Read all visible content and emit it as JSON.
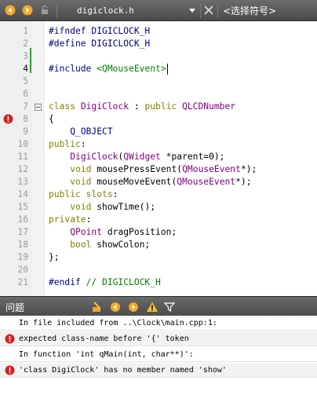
{
  "toolbar": {
    "back_icon": "arrow-left-icon",
    "forward_icon": "arrow-right-icon",
    "lock_icon": "lock-icon",
    "file_name": "digiclock.h",
    "symbol_placeholder": "<选择符号>",
    "accent_color": "#f5a623"
  },
  "editor": {
    "lines": [
      {
        "n": "1",
        "text": "#ifndef DIGICLOCK_H"
      },
      {
        "n": "2",
        "text": "#define DIGICLOCK_H"
      },
      {
        "n": "3",
        "text": ""
      },
      {
        "n": "4",
        "text": "#include <QMouseEvent>"
      },
      {
        "n": "5",
        "text": ""
      },
      {
        "n": "6",
        "text": ""
      },
      {
        "n": "7",
        "text": "class DigiClock : public QLCDNumber"
      },
      {
        "n": "8",
        "text": "{"
      },
      {
        "n": "9",
        "text": "    Q_OBJECT"
      },
      {
        "n": "10",
        "text": "public:"
      },
      {
        "n": "11",
        "text": "    DigiClock(QWidget *parent=0);"
      },
      {
        "n": "12",
        "text": "    void mousePressEvent(QMouseEvent*);"
      },
      {
        "n": "13",
        "text": "    void mouseMoveEvent(QMouseEvent*);"
      },
      {
        "n": "14",
        "text": "public slots:"
      },
      {
        "n": "15",
        "text": "    void showTime();"
      },
      {
        "n": "16",
        "text": "private:"
      },
      {
        "n": "17",
        "text": "    QPoint dragPosition;"
      },
      {
        "n": "18",
        "text": "    bool showColon;"
      },
      {
        "n": "19",
        "text": "};"
      },
      {
        "n": "20",
        "text": ""
      },
      {
        "n": "21",
        "text": "#endif // DIGICLOCK_H"
      }
    ],
    "current_line": "4",
    "error_line": "8",
    "fold_line": "7"
  },
  "issues": {
    "title": "问题",
    "items": [
      {
        "type": "info",
        "text": "In file included from ..\\Clock\\main.cpp:1:"
      },
      {
        "type": "error",
        "text": "expected class-name before '{' token"
      },
      {
        "type": "info",
        "text": "In function 'int qMain(int, char**)':"
      },
      {
        "type": "error",
        "text": "'class DigiClock' has no member named 'show'"
      }
    ]
  }
}
